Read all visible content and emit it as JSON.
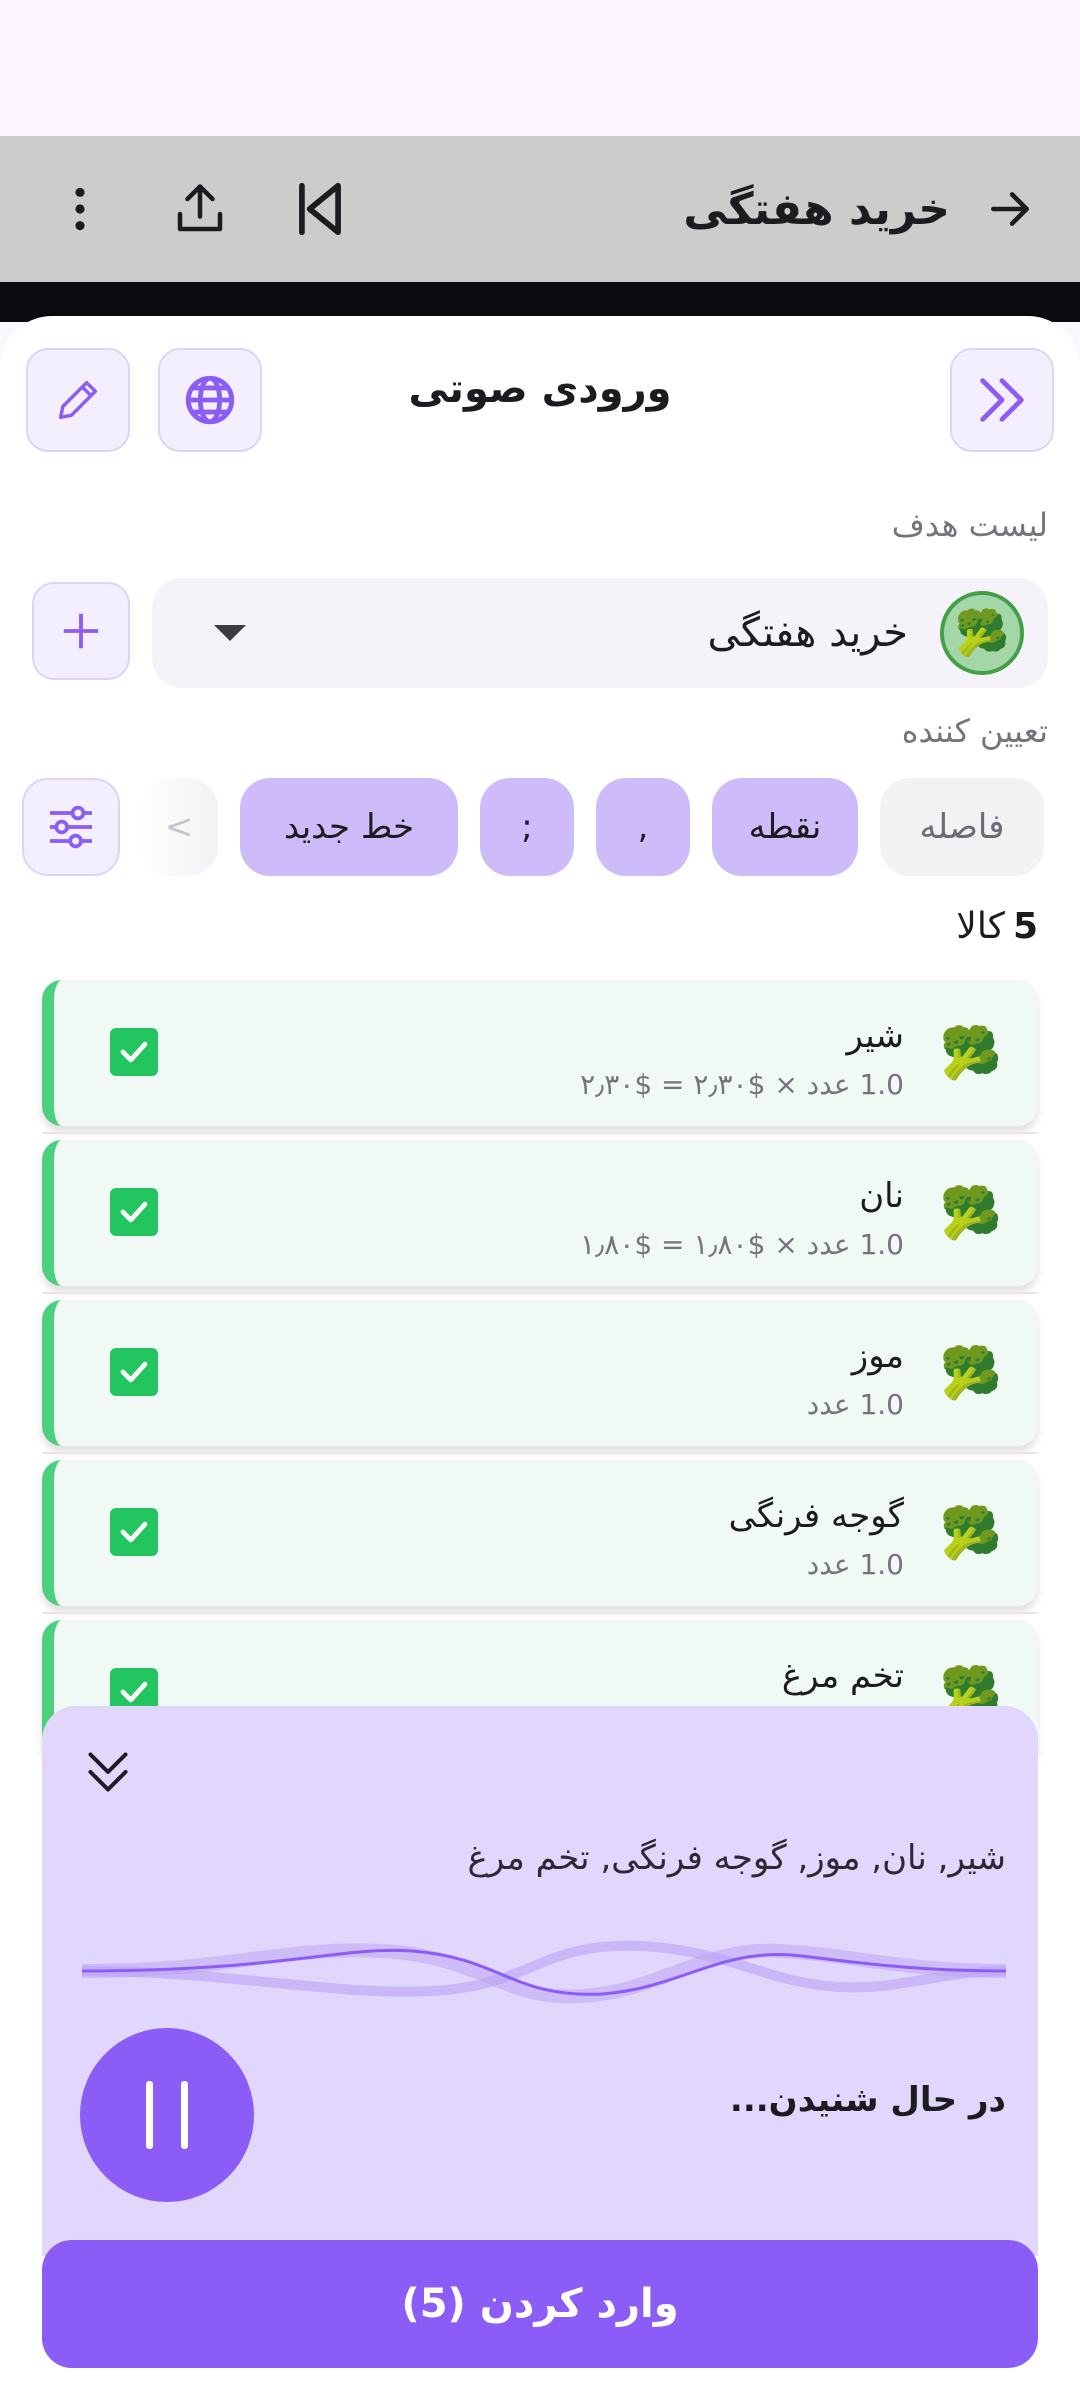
{
  "app_bar": {
    "title": "خرید هفتگی"
  },
  "sheet": {
    "title": "ورودی صوتی",
    "target_label": "لیست هدف",
    "list_name": "خرید هفتگی",
    "list_avatar": "🥦",
    "delimiter_label": "تعیین کننده",
    "delimiters": [
      {
        "label": "فاصله",
        "active": false
      },
      {
        "label": "نقطه",
        "active": true
      },
      {
        "label": ",",
        "active": true
      },
      {
        "label": ";",
        "active": true
      },
      {
        "label": "خط جدید",
        "active": true
      },
      {
        "label": ">",
        "active": false
      }
    ],
    "count_number": "5",
    "count_unit": "کالا"
  },
  "items": [
    {
      "emoji": "🥦",
      "name": "شیر",
      "detail": "1.0 عدد × $۲٫۳۰ = $۲٫۳۰",
      "checked": true
    },
    {
      "emoji": "🥦",
      "name": "نان",
      "detail": "1.0 عدد × $۱٫۸۰ = $۱٫۸۰",
      "checked": true
    },
    {
      "emoji": "🥦",
      "name": "موز",
      "detail": "1.0 عدد",
      "checked": true
    },
    {
      "emoji": "🥦",
      "name": "گوجه فرنگی",
      "detail": "1.0 عدد",
      "checked": true
    },
    {
      "emoji": "🥦",
      "name": "تخم مرغ",
      "detail": "",
      "checked": true
    }
  ],
  "voice": {
    "transcript": "شیر, نان, موز, گوجه فرنگی, تخم مرغ",
    "status": "در حال شنیدن..."
  },
  "submit_label": "وارد کردن (5)",
  "colors": {
    "accent": "#8b5cf6",
    "chip_active": "#cdbcf9",
    "item_bg": "#f1f9f4",
    "item_bar": "#4cd07d",
    "check": "#22c55e",
    "voice_panel": "#e1d6fc"
  },
  "icons": {
    "back": "arrow-right-icon",
    "first": "skip-first-icon",
    "share": "share-icon",
    "more": "more-vertical-icon",
    "collapse": "double-chevron-right-icon",
    "language": "globe-icon",
    "edit": "pencil-icon",
    "add": "plus-icon",
    "tune": "sliders-icon",
    "check": "check-icon",
    "hide": "double-chevron-down-icon",
    "pause": "pause-icon"
  }
}
